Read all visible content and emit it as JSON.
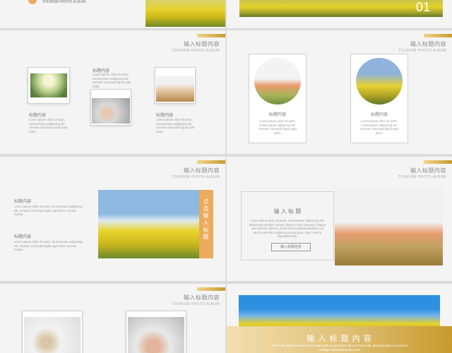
{
  "slide1": {
    "album_label": "TOURISM PHOTO ALBUM",
    "page_number": "01"
  },
  "common": {
    "title": "输入标题内容",
    "subtitle": "TOURISM PHOTO ALBUM",
    "small_title": "标题内容",
    "lorem": "Lorem ipsum dolor sit amet, consectetuer adipiscing elit. Aenean commodo ligula eget dolor.",
    "lorem_short": "Lorem ipsum dolor sit amet, consectetuer adipiscing elit. Aenean commodo ligula eget dolor. Aenean massa."
  },
  "slide4": {
    "card1_title": "标题内容",
    "card2_title": "标题内容"
  },
  "slide5": {
    "vertical_title": "点击输入标题",
    "item1_title": "标题内容",
    "item2_title": "标题内容"
  },
  "slide6": {
    "heading": "输 入 标 题",
    "body": "Lorem ipsum dolor sit amet, consectetuer adipiscing elit. Maecenas porttitor congue massa. Fusce posuere, magna sed pulvinar ultricies, purus lectus malesuada libero, sit amet commodo magna eros quis urna. Nunc viverra imperdiet enim.",
    "button_label": "输入标题信息"
  },
  "slide8": {
    "banner_title": "输 入 标 题 内 容",
    "banner_body": "Pet in the clinical team hold forward with acupuncture all over the body, giving people a record of feelings and keeping the soul."
  },
  "colors": {
    "gold": "#c89a2e",
    "orange": "#ecaa5c",
    "grey_bg": "#f4f4f4"
  }
}
